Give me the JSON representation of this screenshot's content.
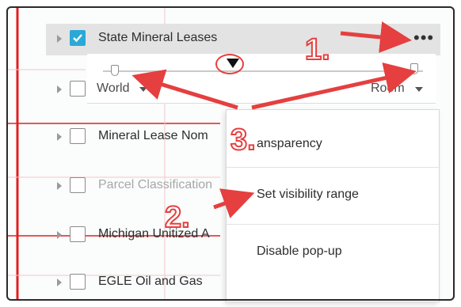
{
  "layers": [
    {
      "label": "State Mineral Leases",
      "checked": true,
      "selected": true,
      "faded": false
    },
    {
      "label": "World",
      "checked": false,
      "selected": false,
      "faded": false
    },
    {
      "label": "Mineral Lease Nom",
      "checked": false,
      "selected": false,
      "faded": false
    },
    {
      "label": "Parcel Classification",
      "checked": false,
      "selected": false,
      "faded": true
    },
    {
      "label": "Michigan Unitized A",
      "checked": false,
      "selected": false,
      "faded": false
    },
    {
      "label": "EGLE Oil and Gas",
      "checked": false,
      "selected": false,
      "faded": false
    }
  ],
  "more_button": "•••",
  "range": {
    "min_label": "World",
    "max_label": "Room"
  },
  "menu": {
    "items": [
      {
        "label": "ansparency"
      },
      {
        "label": "Set visibility range"
      },
      {
        "label": "Disable pop-up"
      }
    ]
  },
  "annotations": {
    "step1": "1.",
    "step2": "2.",
    "step3": "3."
  },
  "colors": {
    "accent_blue": "#2aa9d6",
    "annotation_red": "#e53f3f",
    "selected_row": "#e3e3e3"
  },
  "icons": [
    "checkmark-icon",
    "caret-right-icon",
    "chevron-down-icon",
    "slider-thumb-icon"
  ]
}
